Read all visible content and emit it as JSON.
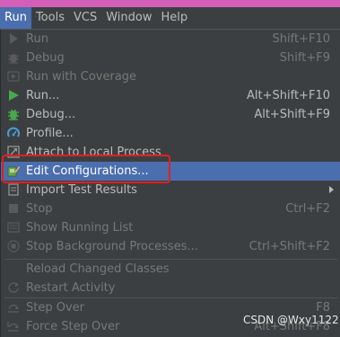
{
  "menubar": {
    "items": [
      {
        "label": "Run",
        "active": true
      },
      {
        "label": "Tools"
      },
      {
        "label": "VCS"
      },
      {
        "label": "Window"
      },
      {
        "label": "Help"
      }
    ]
  },
  "run_menu": {
    "items": [
      {
        "label": "Run",
        "shortcut": "Shift+F10",
        "icon": "run-icon",
        "disabled": true
      },
      {
        "label": "Debug",
        "shortcut": "Shift+F9",
        "icon": "debug-icon",
        "disabled": true
      },
      {
        "label": "Run with Coverage",
        "shortcut": "",
        "icon": "coverage-icon",
        "disabled": true
      },
      {
        "label": "Run...",
        "shortcut": "Alt+Shift+F10",
        "icon": "run-icon",
        "disabled": false
      },
      {
        "label": "Debug...",
        "shortcut": "Alt+Shift+F9",
        "icon": "debug-icon",
        "disabled": false
      },
      {
        "label": "Profile...",
        "shortcut": "",
        "icon": "profile-icon",
        "disabled": false
      },
      {
        "label": "Attach to Local Process",
        "shortcut": "",
        "icon": "attach-icon",
        "disabled": false
      },
      {
        "label": "Edit Configurations...",
        "shortcut": "",
        "icon": "edit-config-icon",
        "disabled": false,
        "selected": true
      },
      {
        "label": "Import Test Results",
        "shortcut": "",
        "icon": "import-icon",
        "disabled": false,
        "submenu": true
      },
      {
        "label": "Stop",
        "shortcut": "Ctrl+F2",
        "icon": "stop-icon",
        "disabled": true
      },
      {
        "label": "Show Running List",
        "shortcut": "",
        "icon": "list-icon",
        "disabled": true
      },
      {
        "label": "Stop Background Processes...",
        "shortcut": "Ctrl+Shift+F2",
        "icon": "stop-bg-icon",
        "disabled": true
      },
      {
        "label": "Reload Changed Classes",
        "shortcut": "",
        "icon": "",
        "disabled": true
      },
      {
        "label": "Restart Activity",
        "shortcut": "",
        "icon": "restart-icon",
        "disabled": true
      },
      {
        "label": "Step Over",
        "shortcut": "F8",
        "icon": "step-over-icon",
        "disabled": true
      },
      {
        "label": "Force Step Over",
        "shortcut": "Alt+Shift+F8",
        "icon": "force-step-icon",
        "disabled": true
      }
    ]
  },
  "colors": {
    "background": "#3c3f41",
    "selection": "#4b6eaf",
    "highlight_box": "#e02020",
    "top_strip": "#d45fb8"
  },
  "watermark": {
    "text": "CSDN @Wxy1122"
  }
}
